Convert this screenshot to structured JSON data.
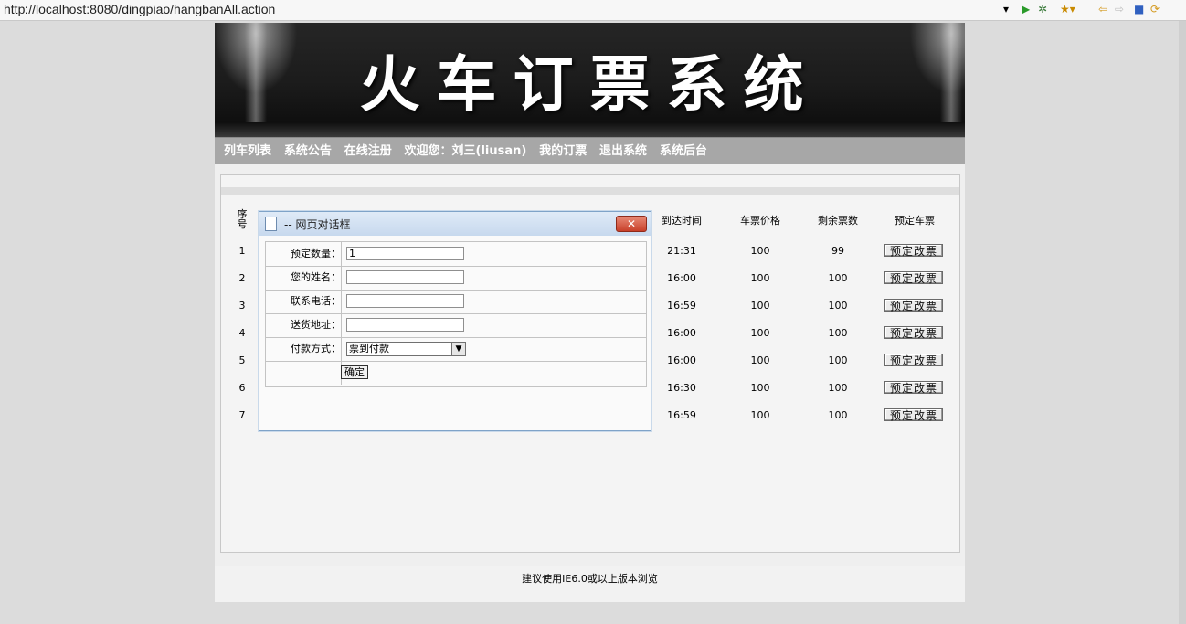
{
  "browser": {
    "url": "http://localhost:8080/dingpiao/hangbanAll.action",
    "toolbar_icons": [
      "dropdown-icon",
      "play-icon",
      "gear-icon",
      "star-icon",
      "back-icon",
      "forward-icon",
      "stop-icon",
      "refresh-icon"
    ]
  },
  "banner": {
    "title": "火车订票系统"
  },
  "nav": {
    "items": [
      {
        "label": "列车列表"
      },
      {
        "label": "系统公告"
      },
      {
        "label": "在线注册"
      },
      {
        "label": "欢迎您：刘三(liusan)"
      },
      {
        "label": "我的订票"
      },
      {
        "label": "退出系统"
      },
      {
        "label": "系统后台"
      }
    ]
  },
  "table": {
    "headers": {
      "index": "序号",
      "arrive": "到达时间",
      "price": "车票价格",
      "remain": "剩余票数",
      "book": "预定车票"
    },
    "rows": [
      {
        "index": "1",
        "arrive": "21:31",
        "price": "100",
        "remain": "99",
        "action": "预定改票"
      },
      {
        "index": "2",
        "arrive": "16:00",
        "price": "100",
        "remain": "100",
        "action": "预定改票"
      },
      {
        "index": "3",
        "arrive": "16:59",
        "price": "100",
        "remain": "100",
        "action": "预定改票"
      },
      {
        "index": "4",
        "arrive": "16:00",
        "price": "100",
        "remain": "100",
        "action": "预定改票"
      },
      {
        "index": "5",
        "arrive": "16:00",
        "price": "100",
        "remain": "100",
        "action": "预定改票"
      },
      {
        "index": "6",
        "arrive": "16:30",
        "price": "100",
        "remain": "100",
        "action": "预定改票"
      },
      {
        "index": "7",
        "arrive": "16:59",
        "price": "100",
        "remain": "100",
        "action": "预定改票"
      }
    ]
  },
  "dialog": {
    "title": "-- 网页对话框",
    "close_label": "✕",
    "fields": [
      {
        "label": "预定数量：",
        "value": "1"
      },
      {
        "label": "您的姓名：",
        "value": ""
      },
      {
        "label": "联系电话：",
        "value": ""
      },
      {
        "label": "送货地址：",
        "value": ""
      }
    ],
    "payment": {
      "label": "付款方式：",
      "selected": "票到付款"
    },
    "confirm_label": "确定"
  },
  "footer": {
    "text": "建议使用IE6.0或以上版本浏览"
  }
}
